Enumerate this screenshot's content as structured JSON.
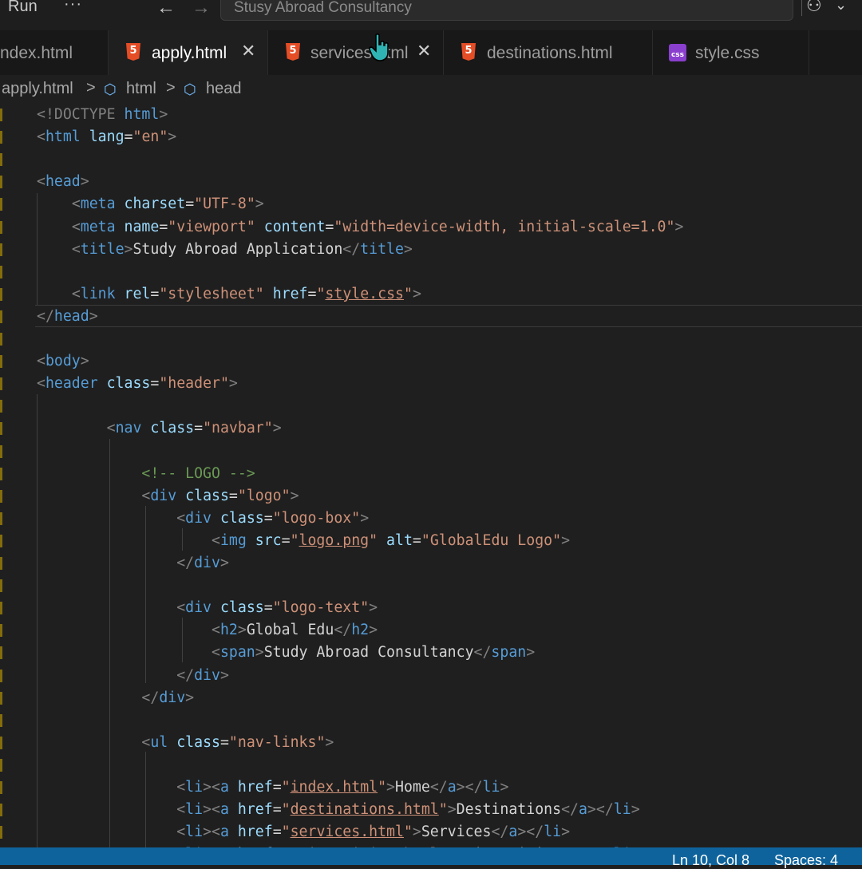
{
  "titlebar": {
    "run_label": "Run",
    "more_label": "···",
    "back_icon": "arrow-left-icon",
    "forward_icon": "arrow-right-icon",
    "search_text": "Stusy Abroad Consultancy",
    "copilot_icon": "copilot-icon",
    "chevron_icon": "chevron-down-icon"
  },
  "tabs": [
    {
      "label": "ndex.html",
      "icon": "html5-icon",
      "active": false
    },
    {
      "label": "apply.html",
      "icon": "html5-icon",
      "active": true,
      "close": "✕"
    },
    {
      "label": "services.html",
      "icon": "html5-icon",
      "active": false,
      "close": "✕"
    },
    {
      "label": "destinations.html",
      "icon": "html5-icon",
      "active": false
    },
    {
      "label": "style.css",
      "icon": "css-icon",
      "active": false
    }
  ],
  "breadcrumb": {
    "file": "apply.html",
    "sep": ">",
    "item1": "html",
    "item2": "head"
  },
  "editor": {
    "lines": [
      "<!DOCTYPE html>",
      "<html lang=\"en\">",
      "",
      "<head>",
      "    <meta charset=\"UTF-8\">",
      "    <meta name=\"viewport\" content=\"width=device-width, initial-scale=1.0\">",
      "    <title>Study Abroad Application</title>",
      "",
      "    <link rel=\"stylesheet\" href=\"style.css\">",
      "</head>",
      "",
      "<body>",
      "<header class=\"header\">",
      "",
      "        <nav class=\"navbar\">",
      "",
      "            <!-- LOGO -->",
      "            <div class=\"logo\">",
      "                <div class=\"logo-box\">",
      "                    <img src=\"logo.png\" alt=\"GlobalEdu Logo\">",
      "                </div>",
      "",
      "                <div class=\"logo-text\">",
      "                    <h2>Global Edu</h2>",
      "                    <span>Study Abroad Consultancy</span>",
      "                </div>",
      "            </div>",
      "",
      "            <ul class=\"nav-links\">",
      "",
      "                <li><a href=\"index.html\">Home</a></li>",
      "                <li><a href=\"destinations.html\">Destinations</a></li>",
      "                <li><a href=\"services.html\">Services</a></li>",
      "                <li><a href=\"universities.html\">Universities</a></li>"
    ]
  },
  "statusbar": {
    "position": "Ln 10, Col 8",
    "spaces": "Spaces: 4"
  },
  "colors": {
    "html_tag": "#569cd6",
    "attr": "#9cdcfe",
    "string": "#ce9178",
    "comment": "#6a9955",
    "status_bg": "#0e639c"
  }
}
